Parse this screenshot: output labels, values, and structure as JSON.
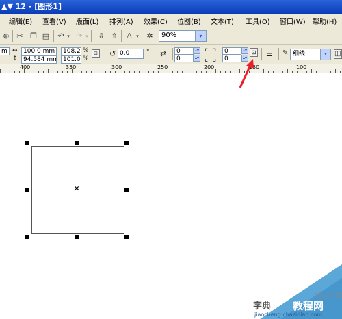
{
  "window": {
    "title": "▲▼ 12 - [图形1]"
  },
  "menu": [
    "编辑(E)",
    "查看(V)",
    "版面(L)",
    "排列(A)",
    "效果(C)",
    "位图(B)",
    "文本(T)",
    "工具(O)",
    "窗口(W)",
    "帮助(H)"
  ],
  "toolbar": {
    "zoom": "90%",
    "zoom_arrow": "▾"
  },
  "propbar": {
    "x_partial": "m",
    "width_value": "100.0 mm",
    "height_value": "94.584 mm",
    "scale_x": "108.2",
    "scale_y": "101.0",
    "percent": "%",
    "rotation": "0.0",
    "degree": "°",
    "corner_tl": "0",
    "corner_bl": "0",
    "corner_tr": "0",
    "corner_br": "0",
    "outline": "细线"
  },
  "ruler": {
    "labels": [
      "400",
      "350",
      "300",
      "250",
      "200",
      "150",
      "100"
    ]
  },
  "watermark": {
    "site": "jb51.net",
    "brand": "教程网",
    "partial": "字典",
    "url": "jiaocheng.chazidian.com"
  },
  "colors": {
    "arrow": "#e8202a",
    "titlebar": "#0a3cb8",
    "watermark": "#5aa7d8"
  }
}
